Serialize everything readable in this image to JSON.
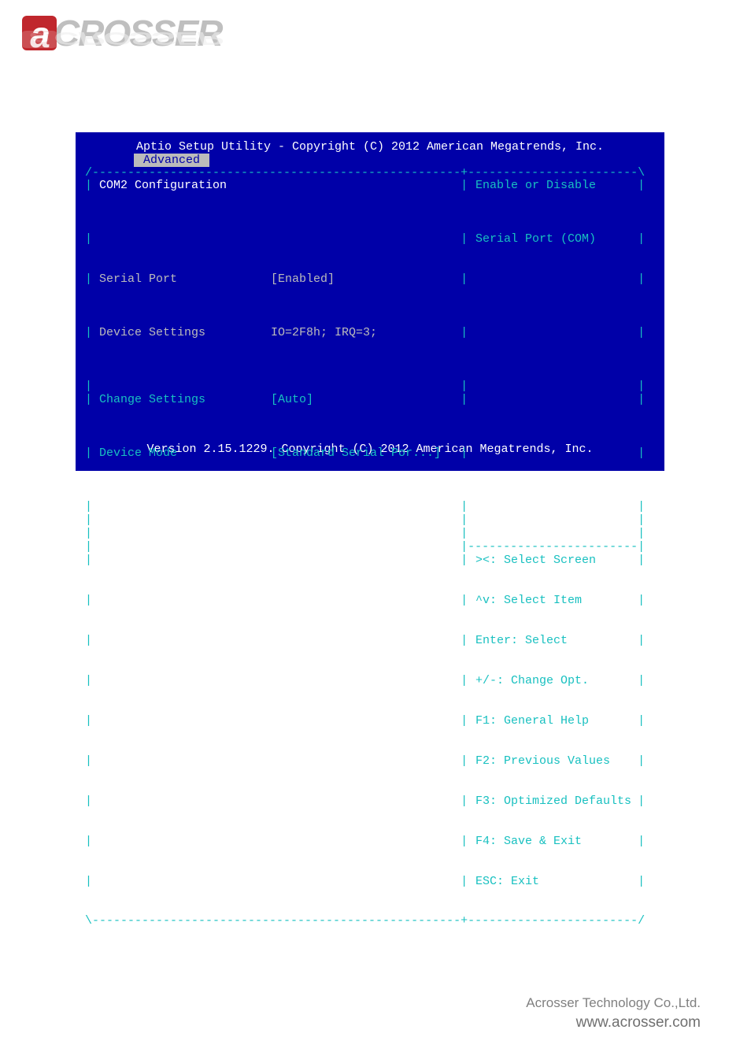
{
  "logo": {
    "alpha": "a",
    "rest": "CROSSER"
  },
  "bios": {
    "title": "Aptio Setup Utility - Copyright (C) 2012 American Megatrends, Inc.",
    "tab": "Advanced",
    "section_title": "COM2 Configuration",
    "items": [
      {
        "label": "Serial Port",
        "value": "[Enabled]",
        "label_color": "gray",
        "value_color": "gray"
      },
      {
        "label": "Device Settings",
        "value": "IO=2F8h; IRQ=3;",
        "label_color": "gray",
        "value_color": "gray"
      },
      {
        "label": "",
        "value": "",
        "label_color": "gray",
        "value_color": "gray"
      },
      {
        "label": "Change Settings",
        "value": "[Auto]",
        "label_color": "cyan",
        "value_color": "cyan"
      },
      {
        "label": "Device Mode",
        "value": "[Standard Serial Por...]",
        "label_color": "cyan",
        "value_color": "cyan"
      }
    ],
    "help": {
      "line1": "Enable or Disable",
      "line2": "Serial Port (COM)"
    },
    "keys": [
      "><: Select Screen",
      "^v: Select Item",
      "Enter: Select",
      "+/-: Change Opt.",
      "F1: General Help",
      "F2: Previous Values",
      "F3: Optimized Defaults",
      "F4: Save & Exit",
      "ESC: Exit"
    ],
    "version": "Version 2.15.1229. Copyright (C) 2012 American Megatrends, Inc."
  },
  "footer": {
    "company": "Acrosser Technology Co.,Ltd.",
    "url": "www.acrosser.com"
  }
}
